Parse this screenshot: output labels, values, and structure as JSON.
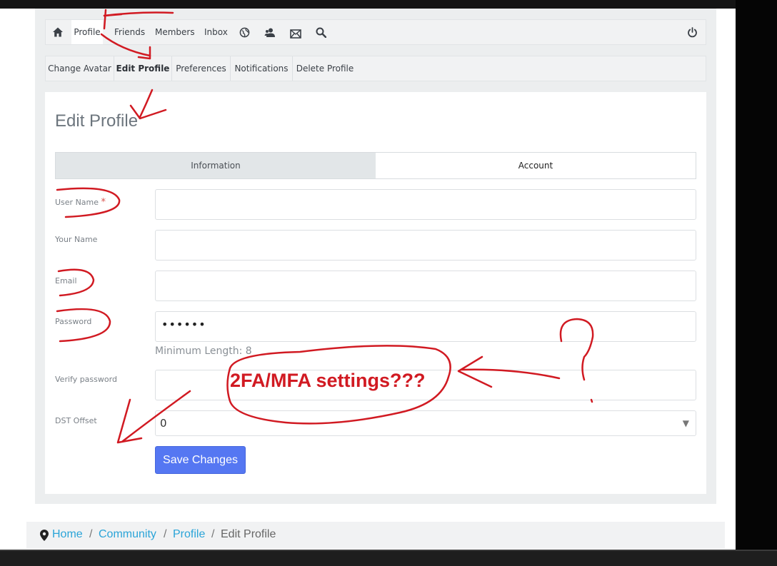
{
  "topnav": {
    "items": [
      "Profile",
      "Friends",
      "Members",
      "Inbox"
    ],
    "icons": [
      "home-icon",
      "globe-icon",
      "users-icon",
      "mail-icon",
      "search-icon",
      "power-icon"
    ]
  },
  "subnav": {
    "items": [
      "Change Avatar",
      "Edit Profile",
      "Preferences",
      "Notifications",
      "Delete Profile"
    ],
    "active": "Edit Profile"
  },
  "page": {
    "title": "Edit Profile",
    "tabs": [
      "Information",
      "Account"
    ],
    "active_tab": "Information"
  },
  "form": {
    "username_label": "User Name",
    "required_mark": "*",
    "yourname_label": "Your Name",
    "email_label": "Email",
    "password_label": "Password",
    "password_value": "••••••",
    "password_help": "Minimum Length: 8",
    "verify_label": "Verify password",
    "dst_label": "DST Offset",
    "dst_value": "0",
    "save_label": "Save Changes"
  },
  "breadcrumb": {
    "items": [
      "Home",
      "Community",
      "Profile",
      "Edit Profile"
    ],
    "separator": "/"
  },
  "annotation": {
    "text": "2FA/MFA settings???",
    "color": "#d11a22"
  },
  "colors": {
    "accent": "#5577f2",
    "link": "#2aa4d8"
  }
}
